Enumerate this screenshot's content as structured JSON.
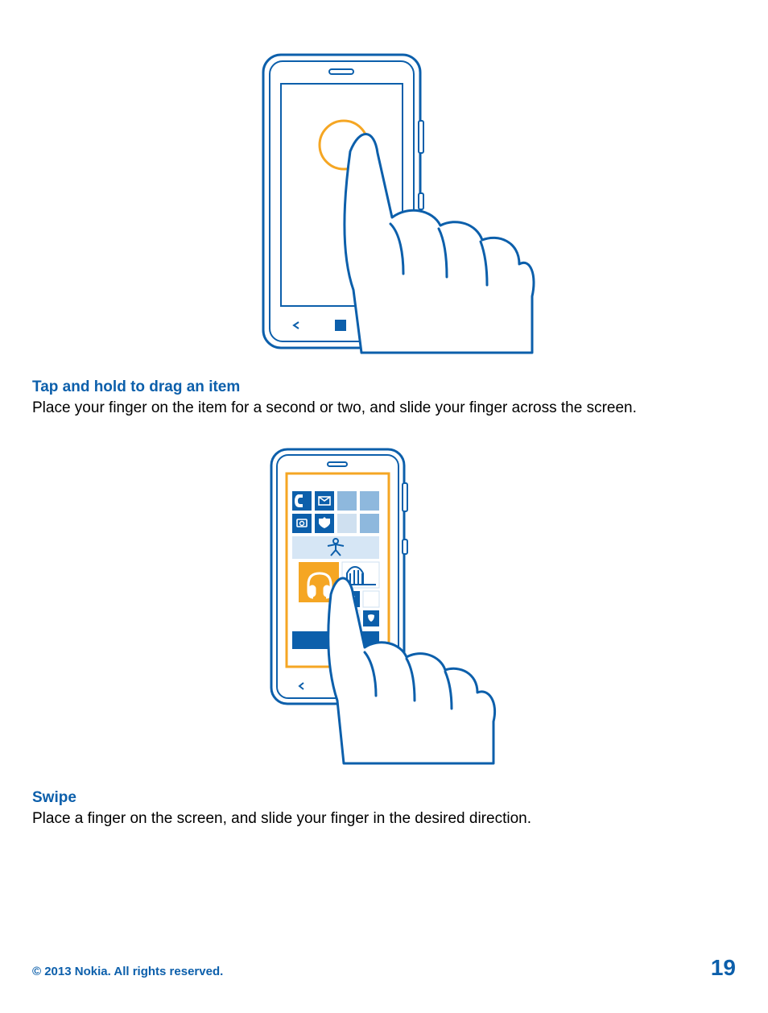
{
  "sections": {
    "tap_hold": {
      "heading": "Tap and hold to drag an item",
      "body": "Place your finger on the item for a second or two, and slide your finger across the screen."
    },
    "swipe": {
      "heading": "Swipe",
      "body": "Place a finger on the screen, and slide your finger in the desired direction."
    }
  },
  "footer": {
    "copyright": "© 2013 Nokia. All rights reserved.",
    "page_number": "19"
  }
}
